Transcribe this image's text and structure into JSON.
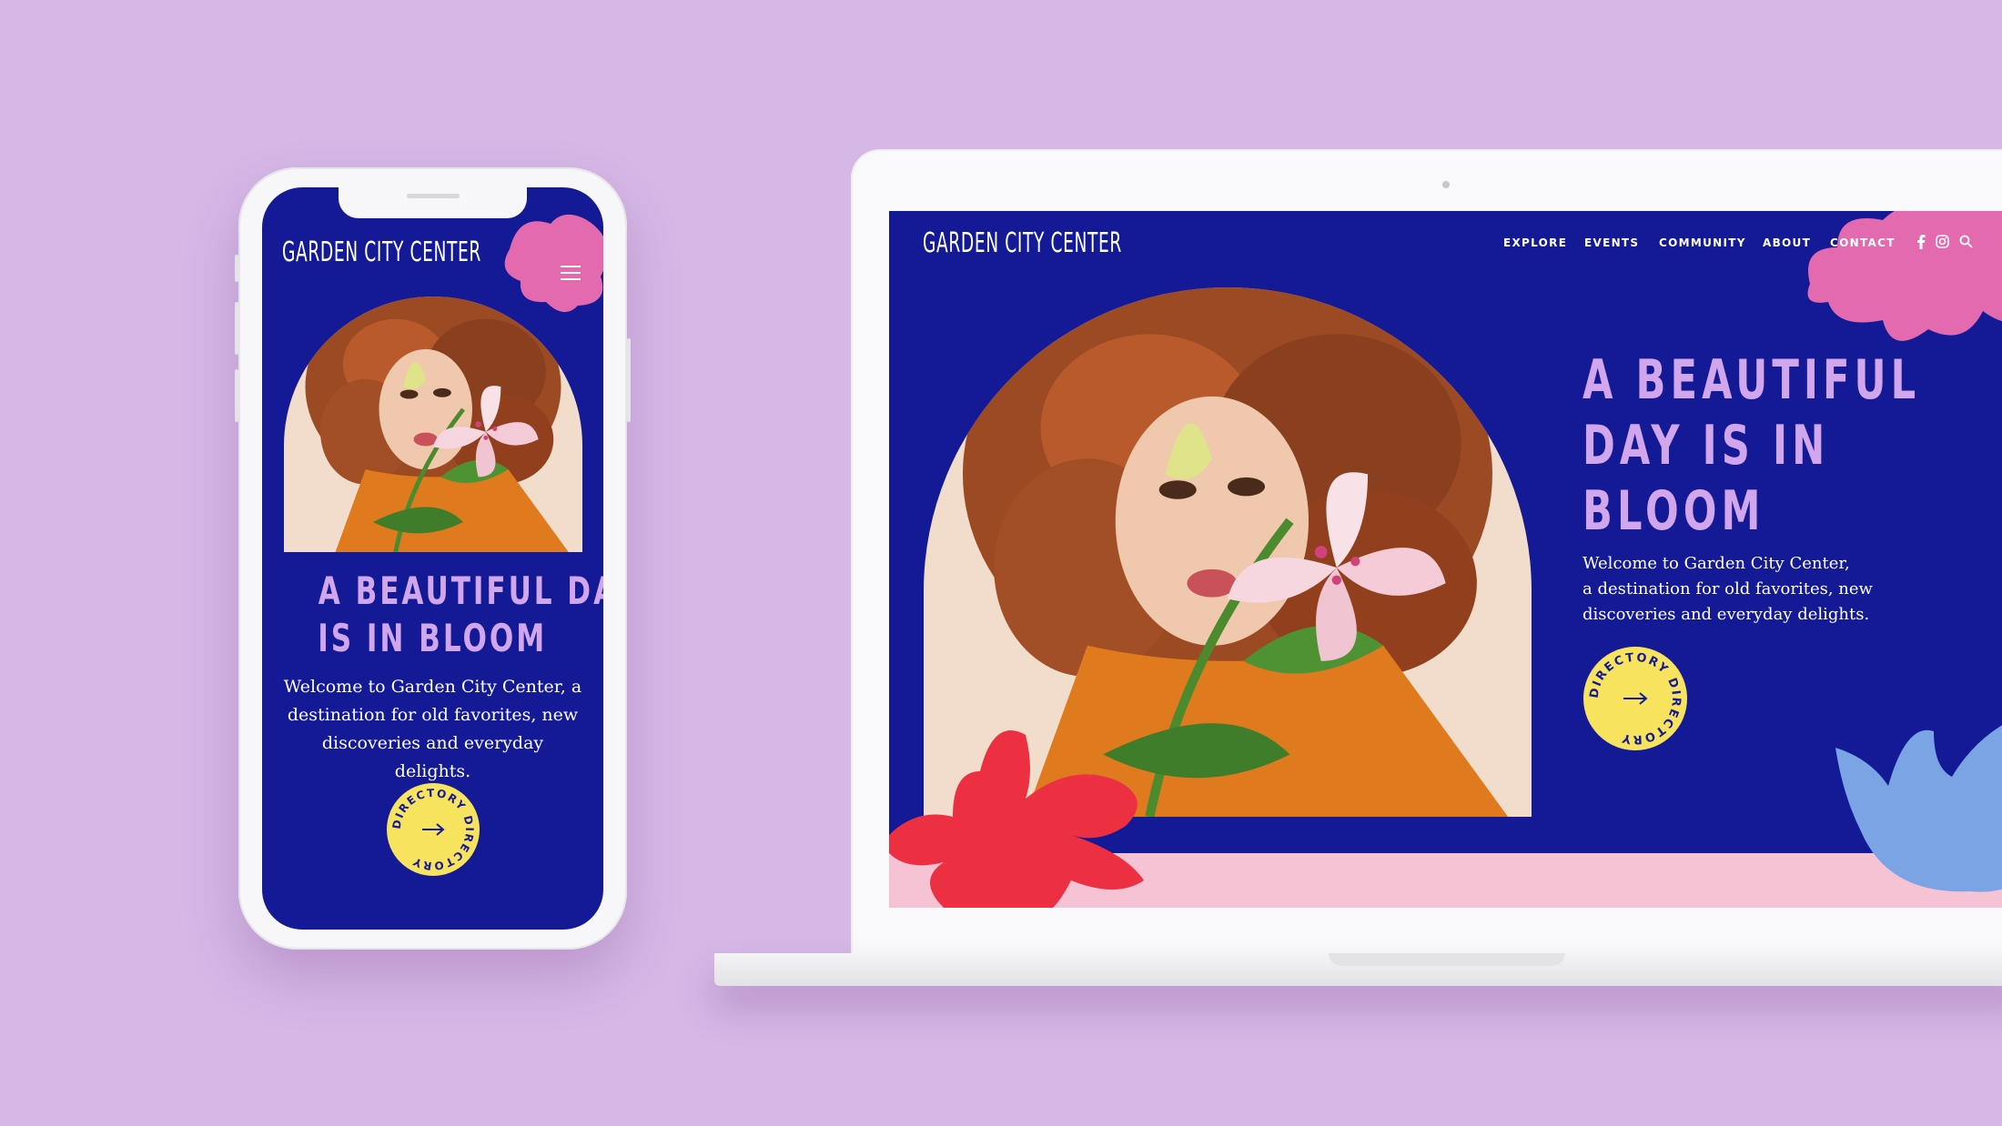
{
  "brand": {
    "name": "GARDEN CITY CENTER",
    "colors": {
      "background": "#d6b7e6",
      "navy": "#141a96",
      "lilac_text": "#d1a6ec",
      "pink_shape": "#e46aaf",
      "red_shape": "#ec2f41",
      "blue_shape": "#7aa4e3",
      "yellow_badge": "#f8e35f",
      "pink_band": "#f5c3d3"
    }
  },
  "mobile": {
    "logo": "GARDEN CITY CENTER",
    "menu_icon": "hamburger-menu-icon",
    "headline_lines": [
      "A BEAUTIFUL DAY",
      "IS IN BLOOM"
    ],
    "intro_lines": [
      "Welcome to Garden City Center, a",
      "destination for old favorites, new",
      "discoveries and everyday delights."
    ],
    "badge_text": "DIRECTORY  DIRECTORY  "
  },
  "desktop": {
    "logo": "GARDEN CITY CENTER",
    "nav": [
      "EXPLORE",
      "EVENTS",
      "COMMUNITY",
      "ABOUT",
      "CONTACT"
    ],
    "social_icons": [
      "facebook-icon",
      "instagram-icon",
      "search-icon"
    ],
    "headline_lines": [
      "A BEAUTIFUL",
      "DAY IS IN",
      "BLOOM"
    ],
    "intro_lines": [
      "Welcome to Garden City Center,",
      "a destination for old favorites, new",
      "discoveries and everyday delights."
    ],
    "badge_text": "DIRECTORY  DIRECTORY  "
  }
}
